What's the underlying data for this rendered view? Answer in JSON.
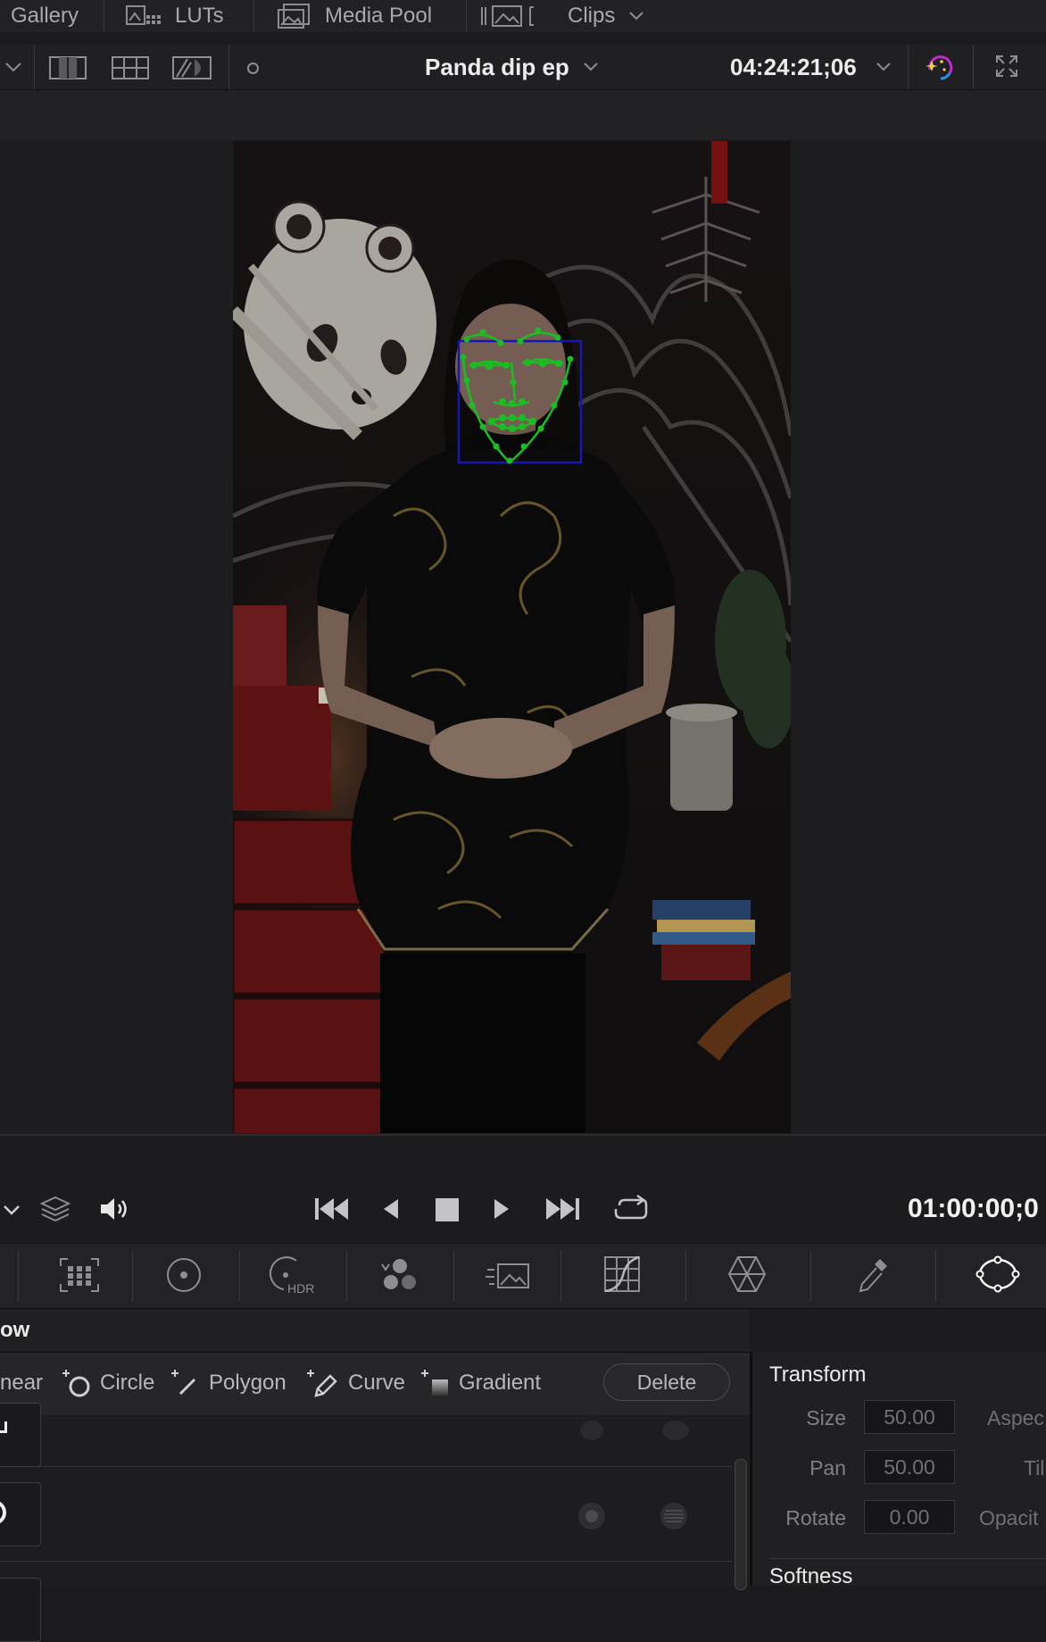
{
  "topnav": {
    "gallery": "Gallery",
    "luts": "LUTs",
    "media_pool": "Media Pool",
    "clips": "Clips"
  },
  "viewer": {
    "clip_name": "Panda dip ep",
    "source_timecode": "04:24:21;06"
  },
  "transport": {
    "record_timecode": "01:00:00;0"
  },
  "panel": {
    "title": "ow"
  },
  "window_tools": {
    "linear": "near",
    "circle": "Circle",
    "polygon": "Polygon",
    "curve": "Curve",
    "gradient": "Gradient",
    "delete": "Delete"
  },
  "transform": {
    "title": "Transform",
    "size_label": "Size",
    "size_value": "50.00",
    "aspect_label": "Aspec",
    "pan_label": "Pan",
    "pan_value": "50.00",
    "tilt_label": "Til",
    "rotate_label": "Rotate",
    "rotate_value": "0.00",
    "opacity_label": "Opacit",
    "softness_title": "Softness"
  },
  "colors": {
    "face_mesh": "#1fe02a",
    "face_box": "#1a1ad0",
    "accent_ring": "#c02bd0"
  }
}
